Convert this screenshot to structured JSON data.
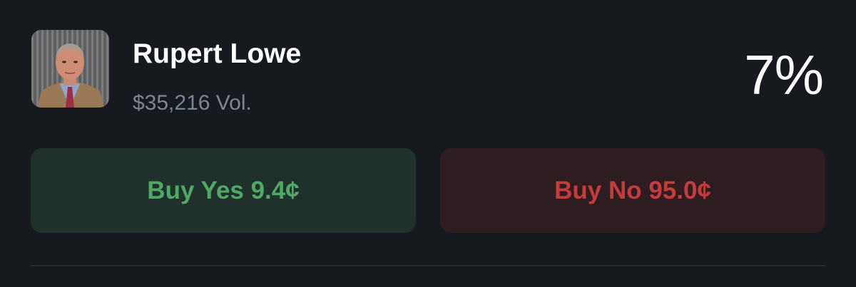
{
  "outcome": {
    "avatar_icon": "person-portrait-photo",
    "name": "Rupert Lowe",
    "volume": "$35,216 Vol.",
    "probability": "7%"
  },
  "actions": {
    "buy_yes_label": "Buy Yes 9.4¢",
    "buy_no_label": "Buy No 95.0¢"
  },
  "colors": {
    "background": "#16191e",
    "yes_text": "#4fa865",
    "yes_bg": "#20312c",
    "no_text": "#c53b3c",
    "no_bg": "#2e1d20",
    "muted_text": "#7d8594"
  }
}
